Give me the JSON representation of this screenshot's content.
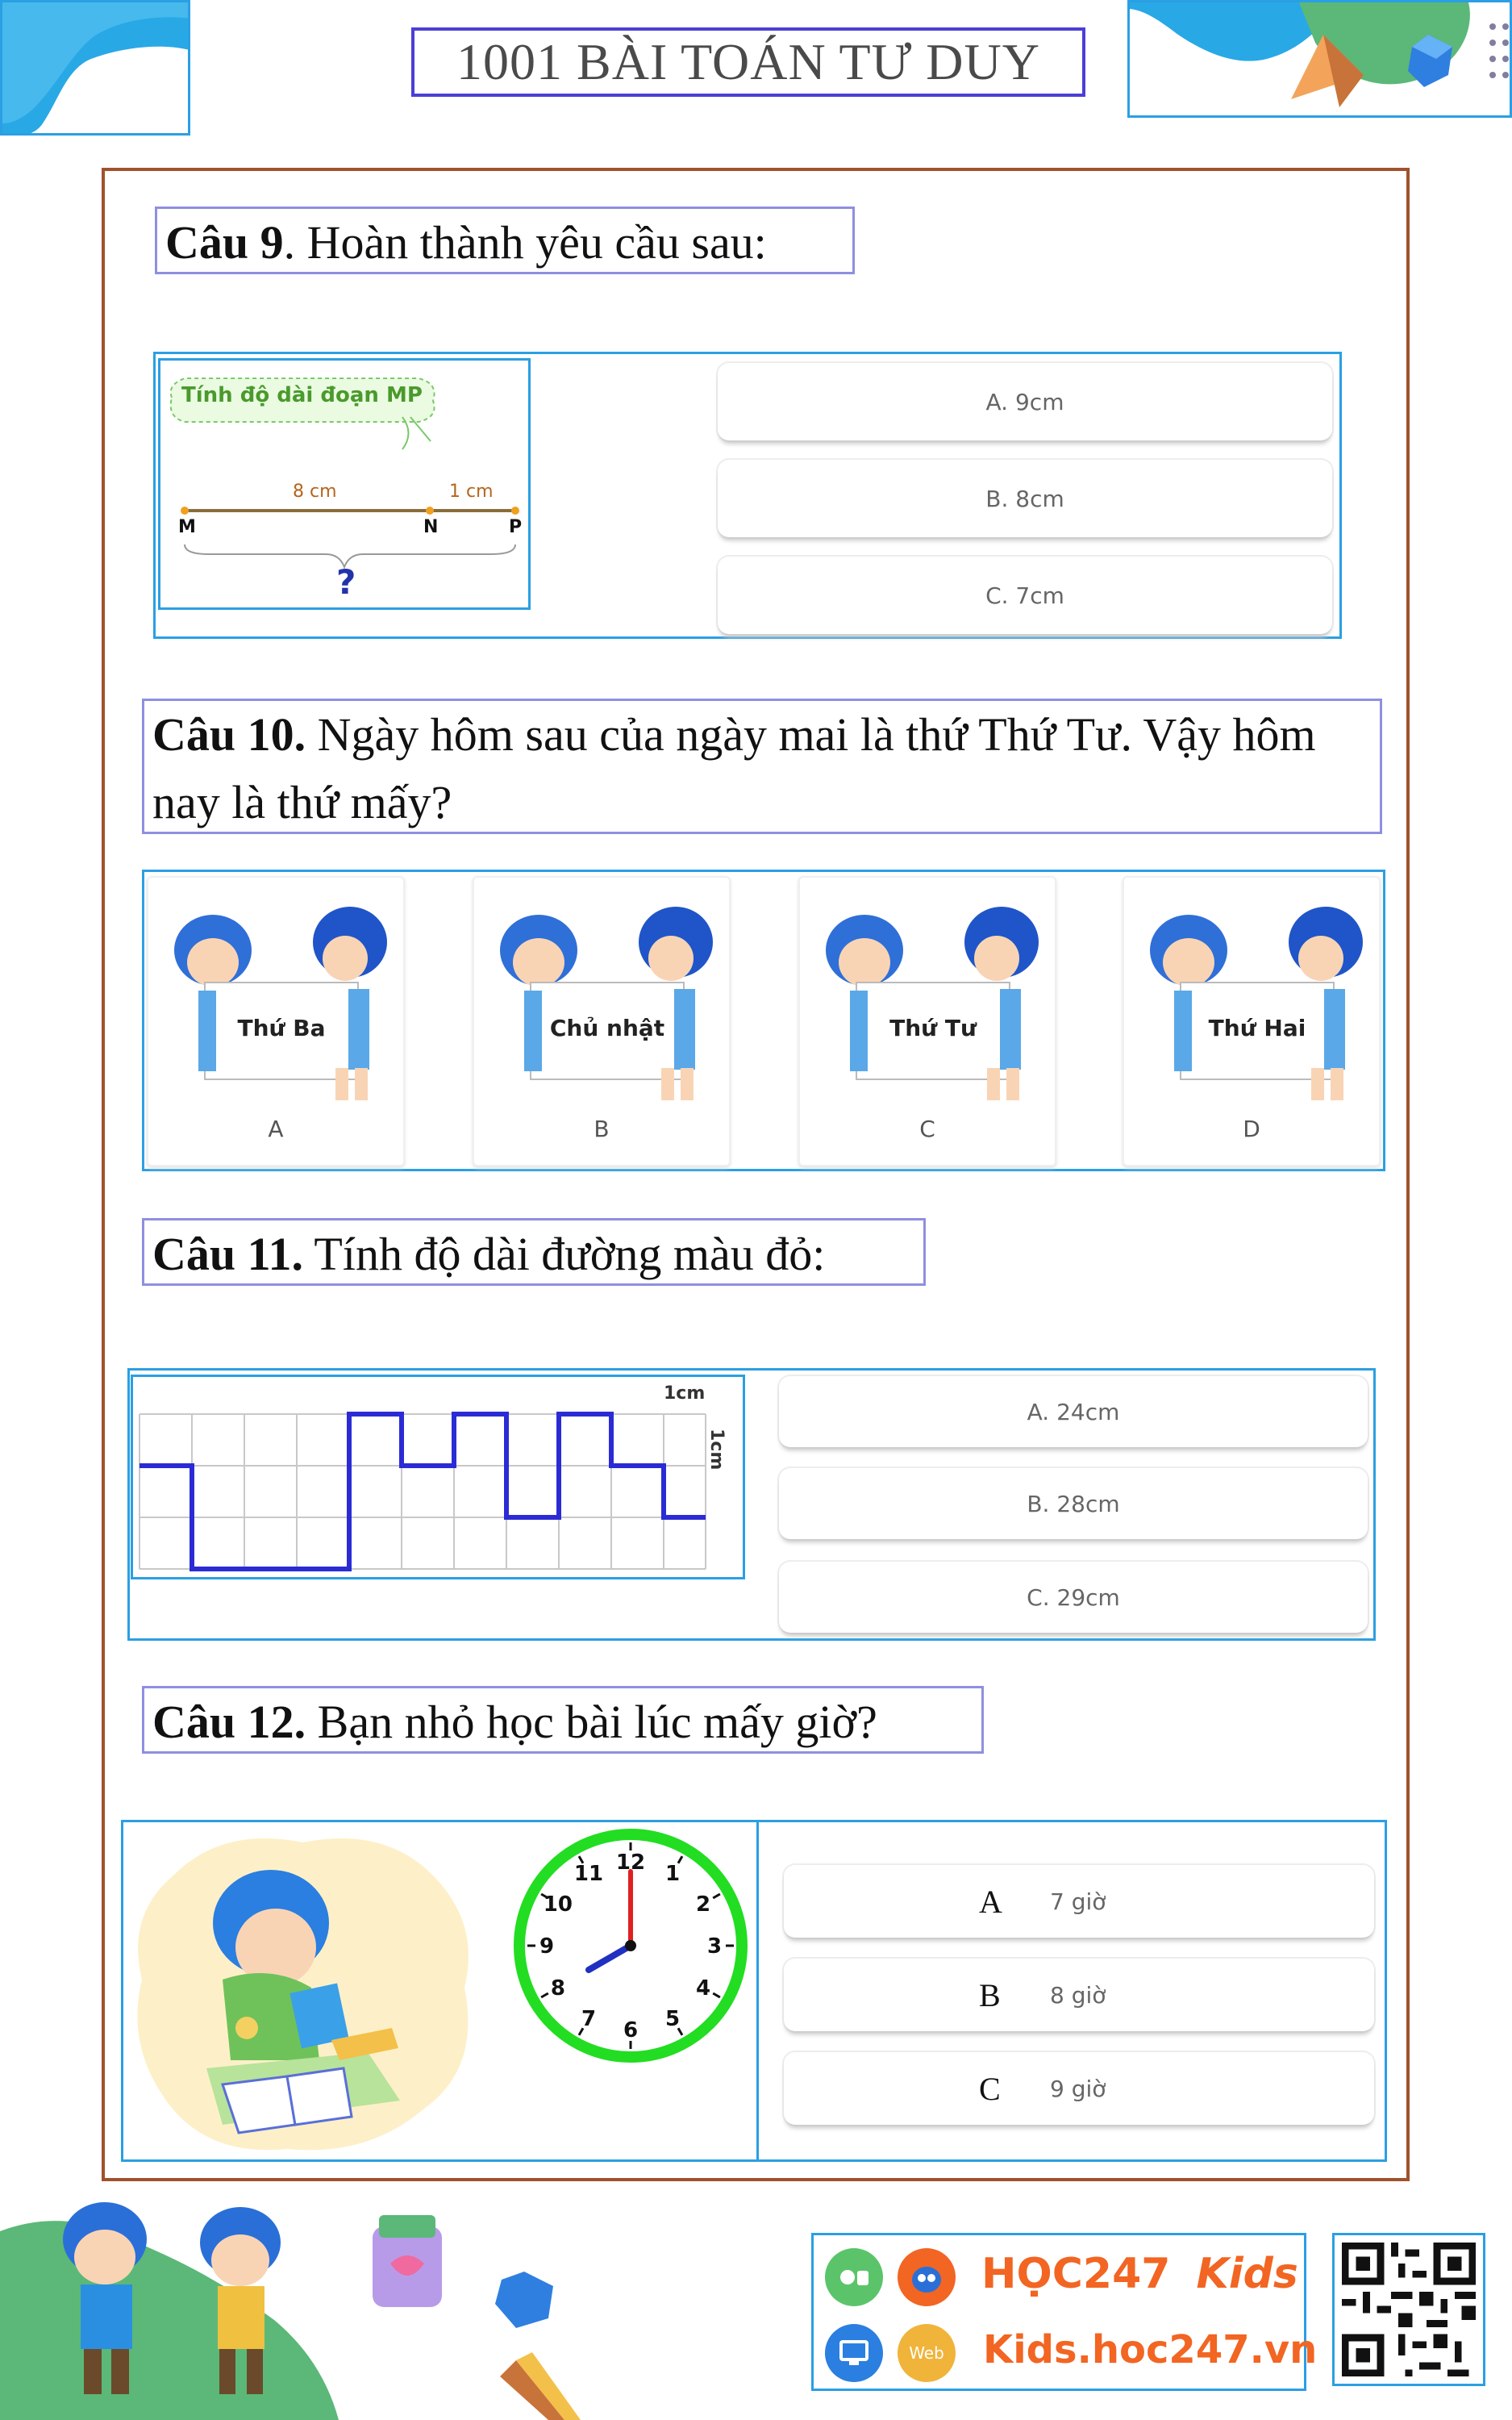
{
  "header": {
    "title": "1001 BÀI TOÁN TƯ DUY"
  },
  "q9": {
    "number": "Câu 9",
    "text": ". Hoàn thành yêu cầu sau:",
    "figure": {
      "banner": "Tính độ dài đoạn MP",
      "seg1": "8 cm",
      "seg2": "1 cm",
      "pM": "M",
      "pN": "N",
      "pP": "P",
      "question": "?"
    },
    "options": [
      "A. 9cm",
      "B. 8cm",
      "C. 7cm"
    ]
  },
  "q10": {
    "number": "Câu 10.",
    "text": " Ngày hôm sau của ngày mai là thứ Thứ Tư. Vậy hôm nay là thứ mấy?",
    "cards": [
      {
        "sign": "Thứ Ba",
        "letter": "A"
      },
      {
        "sign": "Chủ nhật",
        "letter": "B"
      },
      {
        "sign": "Thứ Tư",
        "letter": "C"
      },
      {
        "sign": "Thứ Hai",
        "letter": "D"
      }
    ]
  },
  "q11": {
    "number": "Câu 11.",
    "text": " Tính độ dài đường màu đỏ:",
    "figure": {
      "unit_h": "1cm",
      "unit_v": "1cm",
      "line_color": "#2b2bd6"
    },
    "options": [
      "A. 24cm",
      "B. 28cm",
      "C. 29cm"
    ]
  },
  "q12": {
    "number": "Câu 12.",
    "text": " Bạn nhỏ học bài lúc mấy giờ?",
    "clock": {
      "hour": 8,
      "minute": 0,
      "numbers": [
        "12",
        "1",
        "2",
        "3",
        "4",
        "5",
        "6",
        "7",
        "8",
        "9",
        "10",
        "11"
      ]
    },
    "options": [
      {
        "letter": "A",
        "text": "7 giờ"
      },
      {
        "letter": "B",
        "text": "8 giờ"
      },
      {
        "letter": "C",
        "text": "9 giờ"
      }
    ]
  },
  "footer": {
    "brand_top": "HỌC247",
    "brand_kids": "Kids",
    "site": "Kids.hoc247.vn",
    "web_label": "Web"
  },
  "colors": {
    "accent_blue": "#2b9fe3",
    "title_border": "#4b3fd6",
    "frame": "#a0522d",
    "clock_green": "#22dd22",
    "brand_orange": "#f26522"
  }
}
